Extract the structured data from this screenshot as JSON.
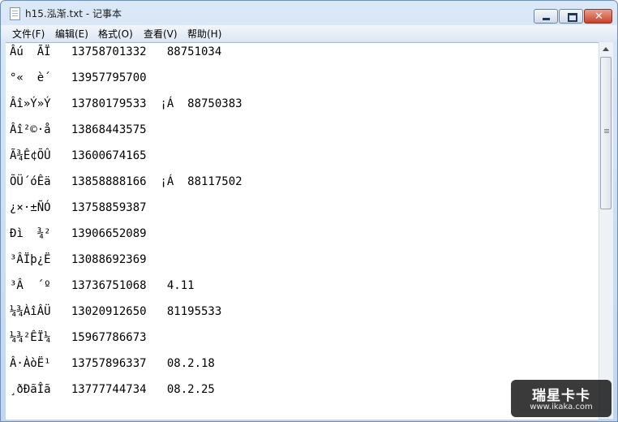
{
  "window": {
    "title": "h15.泓渐.txt - 记事本",
    "buttons": {
      "minimize": "",
      "maximize": "",
      "close": "✕"
    }
  },
  "menu": [
    {
      "label": "文件(F)"
    },
    {
      "label": "编辑(E)"
    },
    {
      "label": "格式(O)"
    },
    {
      "label": "查看(V)"
    },
    {
      "label": "帮助(H)"
    }
  ],
  "content": {
    "lines": [
      "Âú  ÃÏ   13758701332   88751034",
      "°«  è´   13957795700",
      "Âî»Ý»Ý   13780179533  ¡Á  88750383",
      "Âî²©·å   13868443575",
      "Ã¾Ê¢ÕÛ   13600674165",
      "ÕÜ´óÊä   13858888166  ¡Á  88117502",
      "¿×·±ÑÓ   13758859387",
      "Ðì  ¾²   13906652089",
      "³ÂÏþ¿Ë   13088692369",
      "³Â  ´º   13736751068   4.11",
      "¼¾ÀîÂÜ   13020912650   81195533",
      "¼¾²ÊÏ¼   15967786673",
      "Â·ÀòË¹   13757896337   08.2.18",
      "¸ðÐãÎã   13777744734   08.2.25"
    ]
  },
  "watermark": {
    "name": "瑞星卡卡",
    "url": "www.ikaka.com"
  }
}
